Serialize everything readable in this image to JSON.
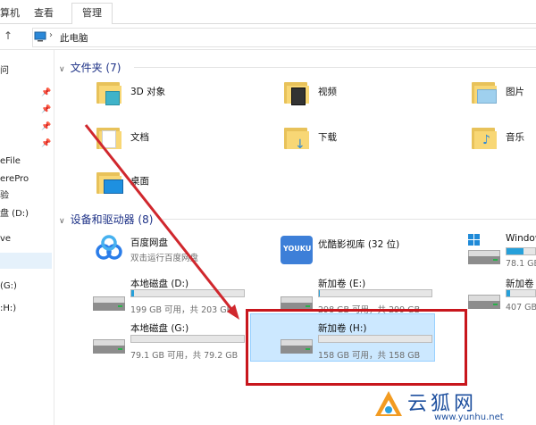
{
  "ribbon": {
    "tabs": [
      {
        "label": "算机",
        "active": false
      },
      {
        "label": "查看",
        "active": false
      },
      {
        "label": "管理",
        "active": true
      }
    ]
  },
  "address": {
    "path": "此电脑"
  },
  "nav": {
    "items": [
      "问",
      "eFile",
      "erePro",
      "验",
      "盘 (D:)",
      "ve",
      "(G:)",
      ":H:)"
    ]
  },
  "folders_section": {
    "title": "文件夹 (7)",
    "items": [
      "3D 对象",
      "视频",
      "图片",
      "文档",
      "下载",
      "音乐",
      "桌面"
    ]
  },
  "devices_section": {
    "title": "设备和驱动器 (8)",
    "items": [
      {
        "name": "百度网盘",
        "sub": "双击运行百度网盘"
      },
      {
        "name": "优酷影视库 (32 位)"
      },
      {
        "name": "Window",
        "sub": "78.1 GB",
        "used_fraction": 0.6
      },
      {
        "name": "本地磁盘 (D:)",
        "sub": "199 GB 可用，共 203 GB",
        "used_fraction": 0.02
      },
      {
        "name": "新加卷 (E:)",
        "sub": "298 GB 可用，共 299 GB",
        "used_fraction": 0.01
      },
      {
        "name": "新加卷",
        "sub": "407 GB",
        "used_fraction": 0.12
      },
      {
        "name": "本地磁盘 (G:)",
        "sub": "79.1 GB 可用，共 79.2 GB",
        "used_fraction": 0.0
      },
      {
        "name": "新加卷 (H:)",
        "sub": "158 GB 可用，共 158 GB",
        "used_fraction": 0.0
      }
    ]
  },
  "watermark": {
    "brand": "云狐网",
    "url": "www.yunhu.net"
  },
  "colors": {
    "accent": "#26a0da",
    "selection": "#cce8ff",
    "annotation": "#c8161d"
  }
}
